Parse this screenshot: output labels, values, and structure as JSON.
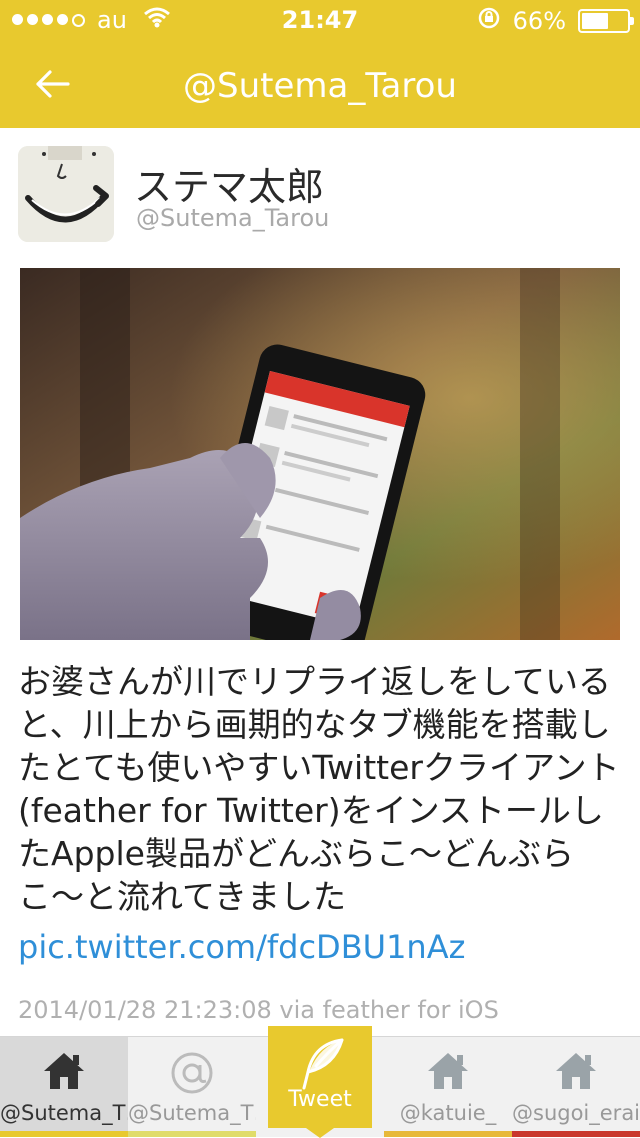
{
  "status_bar": {
    "carrier": "au",
    "time": "21:47",
    "battery_percent": "66%",
    "battery_level": 0.66,
    "signal_bars_filled": 4,
    "signal_bars_total": 5
  },
  "nav": {
    "title": "@Sutema_Tarou",
    "back_icon": "arrow-left-icon"
  },
  "profile": {
    "name": "ステマ太郎",
    "handle": "@Sutema_Tarou"
  },
  "tweet": {
    "text": "お婆さんが川でリプライ返しをしていると、川上から画期的なタブ機能を搭載したとても使いやすいTwitterクライアント(feather for Twitter)をインストールしたApple製品がどんぶらこ〜どんぶらこ〜と流れてきました",
    "link": "pic.twitter.com/fdcDBU1nAz",
    "meta": "2014/01/28 21:23:08 via feather for iOS"
  },
  "tabs": [
    {
      "label": "@Sutema_T…",
      "icon": "home-icon",
      "active": true
    },
    {
      "label": "@Sutema_T…",
      "icon": "at-icon",
      "active": false
    },
    {
      "label": "@katuie_",
      "icon": "home-icon",
      "active": false
    },
    {
      "label": "@sugoi_erai…",
      "icon": "home-icon",
      "active": false
    }
  ],
  "tweet_button": {
    "label": "Tweet",
    "icon": "feather-icon"
  },
  "colors": {
    "accent": "#e8c92e",
    "link": "#2f8fd8",
    "tab_underline_1": "#e8c92e",
    "tab_underline_2": "#e0dc6a",
    "tab_underline_3": "#e7b93a",
    "tab_underline_4": "#c9372c"
  }
}
